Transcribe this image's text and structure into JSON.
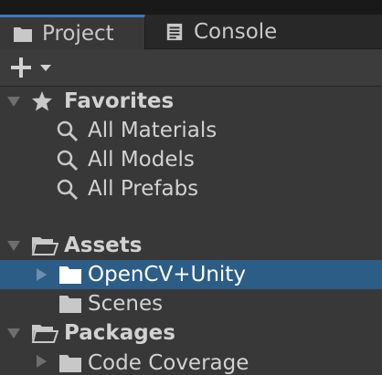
{
  "tabs": [
    {
      "label": "Project",
      "icon": "folder-icon"
    },
    {
      "label": "Console",
      "icon": "console-icon"
    }
  ],
  "toolbar": {
    "add_icon": "plus-icon",
    "dropdown_icon": "chevron-down-icon"
  },
  "tree": {
    "favorites": {
      "label": "Favorites",
      "items": [
        "All Materials",
        "All Models",
        "All Prefabs"
      ]
    },
    "assets": {
      "label": "Assets",
      "items": [
        {
          "label": "OpenCV+Unity",
          "selected": true,
          "expandable": true
        },
        {
          "label": "Scenes",
          "selected": false,
          "expandable": false
        }
      ]
    },
    "packages": {
      "label": "Packages",
      "items": [
        {
          "label": "Code Coverage",
          "expandable": true
        }
      ]
    }
  },
  "colors": {
    "background": "#383838",
    "selection": "#2c5d87",
    "tab_accent": "#3a79bb",
    "text": "#d2d2d2"
  }
}
